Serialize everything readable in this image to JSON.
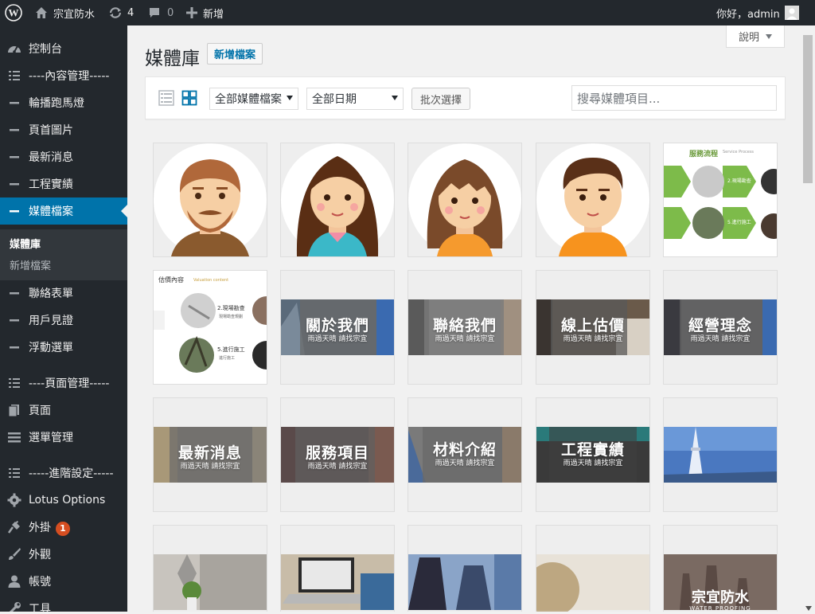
{
  "adminbar": {
    "site_name": "宗宜防水",
    "updates_count": "4",
    "comments_count": "0",
    "new_label": "新增",
    "greeting": "你好，admin"
  },
  "sidebar": {
    "items": [
      {
        "label": "控制台",
        "icon": "dashboard-icon"
      },
      {
        "label": "----內容管理-----",
        "icon": "list-icon"
      },
      {
        "label": "輪播跑馬燈",
        "icon": "dash-icon"
      },
      {
        "label": "頁首圖片",
        "icon": "dash-icon"
      },
      {
        "label": "最新消息",
        "icon": "dash-icon"
      },
      {
        "label": "工程實績",
        "icon": "dash-icon"
      },
      {
        "label": "媒體檔案",
        "icon": "dash-icon",
        "current": true
      },
      {
        "label": "聯絡表單",
        "icon": "dash-icon"
      },
      {
        "label": "用戶見證",
        "icon": "dash-icon"
      },
      {
        "label": "浮動選單",
        "icon": "dash-icon"
      },
      {
        "label": "----頁面管理-----",
        "icon": "list-icon"
      },
      {
        "label": "頁面",
        "icon": "page-icon"
      },
      {
        "label": "選單管理",
        "icon": "menu-icon"
      },
      {
        "label": "-----進階設定-----",
        "icon": "list-icon"
      },
      {
        "label": "Lotus Options",
        "icon": "gear-icon"
      },
      {
        "label": "外掛",
        "icon": "plugin-icon",
        "badge": "1"
      },
      {
        "label": "外觀",
        "icon": "brush-icon"
      },
      {
        "label": "帳號",
        "icon": "user-icon"
      },
      {
        "label": "工具",
        "icon": "tool-icon"
      }
    ],
    "submenu": [
      {
        "label": "媒體庫",
        "active": true
      },
      {
        "label": "新增檔案"
      }
    ]
  },
  "main": {
    "help_label": "說明",
    "title": "媒體庫",
    "add_new_label": "新增檔案",
    "filter_type": "全部媒體檔案",
    "filter_date": "全部日期",
    "bulk_select_label": "批次選擇",
    "search_placeholder": "搜尋媒體項目..."
  },
  "media": {
    "accent": "#0073aa",
    "service_title": "服務流程",
    "service_title_en": "Service Process",
    "service_step2": "2.現場勘查",
    "service_step5": "5.進行施工",
    "valuation_title": "估價內容",
    "valuation_title_en": "Valuation content",
    "valuation_step2": "2.現場勘查",
    "valuation_step2_sub": "現場勘查規劃",
    "valuation_step5": "5.進行施工",
    "valuation_step5_sub": "進行施工",
    "banner_about": "關於我們",
    "banner_contact": "聯絡我們",
    "banner_quote": "線上估價",
    "banner_philosophy": "經營理念",
    "banner_news": "最新消息",
    "banner_services": "服務項目",
    "banner_materials": "材料介紹",
    "banner_projects": "工程實績",
    "banner_sub": "雨過天晴 請找宗宜",
    "brand_cn": "宗宜防水",
    "brand_en": "WATER PROOFING"
  }
}
